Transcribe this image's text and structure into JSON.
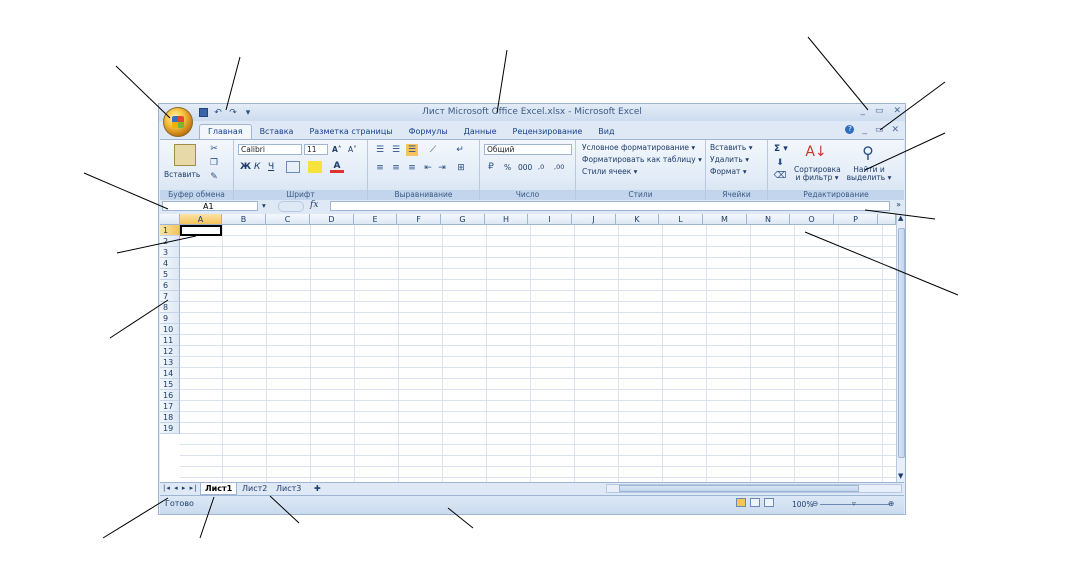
{
  "app": {
    "title": "Лист Microsoft Office Excel.xlsx - Microsoft Excel",
    "window_controls": [
      "_",
      "▭",
      "✕"
    ],
    "app_controls": [
      "?",
      "_",
      "▭",
      "✕"
    ]
  },
  "quick_access": {
    "undo": "↶",
    "redo": "↷",
    "customize": "▾"
  },
  "tabs": [
    "Главная",
    "Вставка",
    "Разметка страницы",
    "Формулы",
    "Данные",
    "Рецензирование",
    "Вид"
  ],
  "ribbon": {
    "clipboard": {
      "label": "Буфер обмена",
      "paste": "Вставить"
    },
    "font": {
      "label": "Шрифт",
      "name": "Calibri",
      "size": "11",
      "bold": "Ж",
      "italic": "К",
      "underline": "Ч",
      "grow": "A˄",
      "shrink": "A˅"
    },
    "alignment": {
      "label": "Выравнивание"
    },
    "number": {
      "label": "Число",
      "format": "Общий",
      "percent": "%",
      "thousands": "000",
      "inc": ",0",
      "dec": ",00"
    },
    "styles": {
      "label": "Стили",
      "conditional": "Условное форматирование ▾",
      "as_table": "Форматировать как таблицу ▾",
      "cell_styles": "Стили ячеек ▾"
    },
    "cells": {
      "label": "Ячейки",
      "insert": "Вставить ▾",
      "delete": "Удалить ▾",
      "format": "Формат ▾"
    },
    "editing": {
      "label": "Редактирование",
      "sum": "Σ ▾",
      "sort": "Сортировка и фильтр ▾",
      "find": "Найти и выделить ▾"
    }
  },
  "formula_bar": {
    "name_box": "A1",
    "fx": "fx"
  },
  "columns": [
    "A",
    "B",
    "C",
    "D",
    "E",
    "F",
    "G",
    "H",
    "I",
    "J",
    "K",
    "L",
    "M",
    "N",
    "O",
    "P"
  ],
  "rows": [
    "1",
    "2",
    "3",
    "4",
    "5",
    "6",
    "7",
    "8",
    "9",
    "10",
    "11",
    "12",
    "13",
    "14",
    "15",
    "16",
    "17",
    "18",
    "19"
  ],
  "sheet_tabs": [
    "Лист1",
    "Лист2",
    "Лист3"
  ],
  "status": {
    "ready": "Готово",
    "zoom": "100%"
  },
  "colors": {
    "accent": "#15428b",
    "ribbon": "#dfe8f5",
    "selected_header": "#f5c45c"
  }
}
